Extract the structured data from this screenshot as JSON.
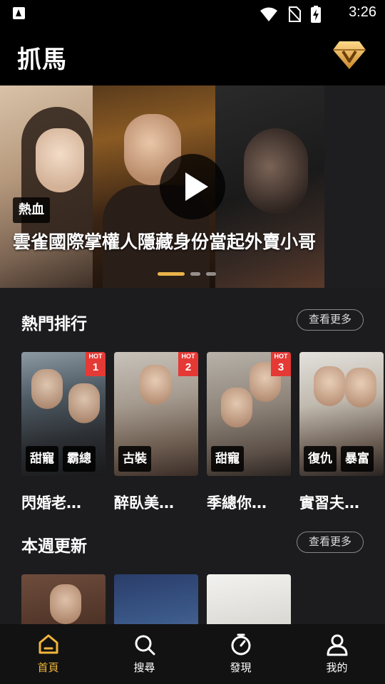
{
  "status_bar": {
    "time": "3:26",
    "icons": [
      "app-a-icon",
      "wifi-icon",
      "no-sim-icon",
      "battery-charging-icon"
    ]
  },
  "header": {
    "title": "抓馬",
    "vip_icon": "vip-diamond-icon"
  },
  "banner": {
    "genre_tag": "熱血",
    "title": "雲雀國際掌權人隱藏身份當起外賣小哥",
    "slide_count": 3,
    "active_slide": 1
  },
  "sections": {
    "hot": {
      "title": "熱門排行",
      "more_label": "查看更多",
      "items": [
        {
          "title": "閃婚老…",
          "rank_label": "HOT",
          "rank": "1",
          "tags": [
            "甜寵",
            "霸總"
          ]
        },
        {
          "title": "醉臥美…",
          "rank_label": "HOT",
          "rank": "2",
          "tags": [
            "古裝"
          ]
        },
        {
          "title": "季總你…",
          "rank_label": "HOT",
          "rank": "3",
          "tags": [
            "甜寵"
          ]
        },
        {
          "title": "實習夫…",
          "tags": [
            "復仇",
            "暴富"
          ]
        }
      ]
    },
    "weekly": {
      "title": "本週更新",
      "more_label": "查看更多"
    }
  },
  "bottom_nav": {
    "items": [
      {
        "label": "首頁",
        "icon": "home-icon",
        "active": true
      },
      {
        "label": "搜尋",
        "icon": "search-icon",
        "active": false
      },
      {
        "label": "發現",
        "icon": "discover-icon",
        "active": false
      },
      {
        "label": "我的",
        "icon": "profile-icon",
        "active": false
      }
    ]
  },
  "colors": {
    "accent": "#f0b53c",
    "hot_badge": "#e53935",
    "background": "#1c1c1e"
  }
}
